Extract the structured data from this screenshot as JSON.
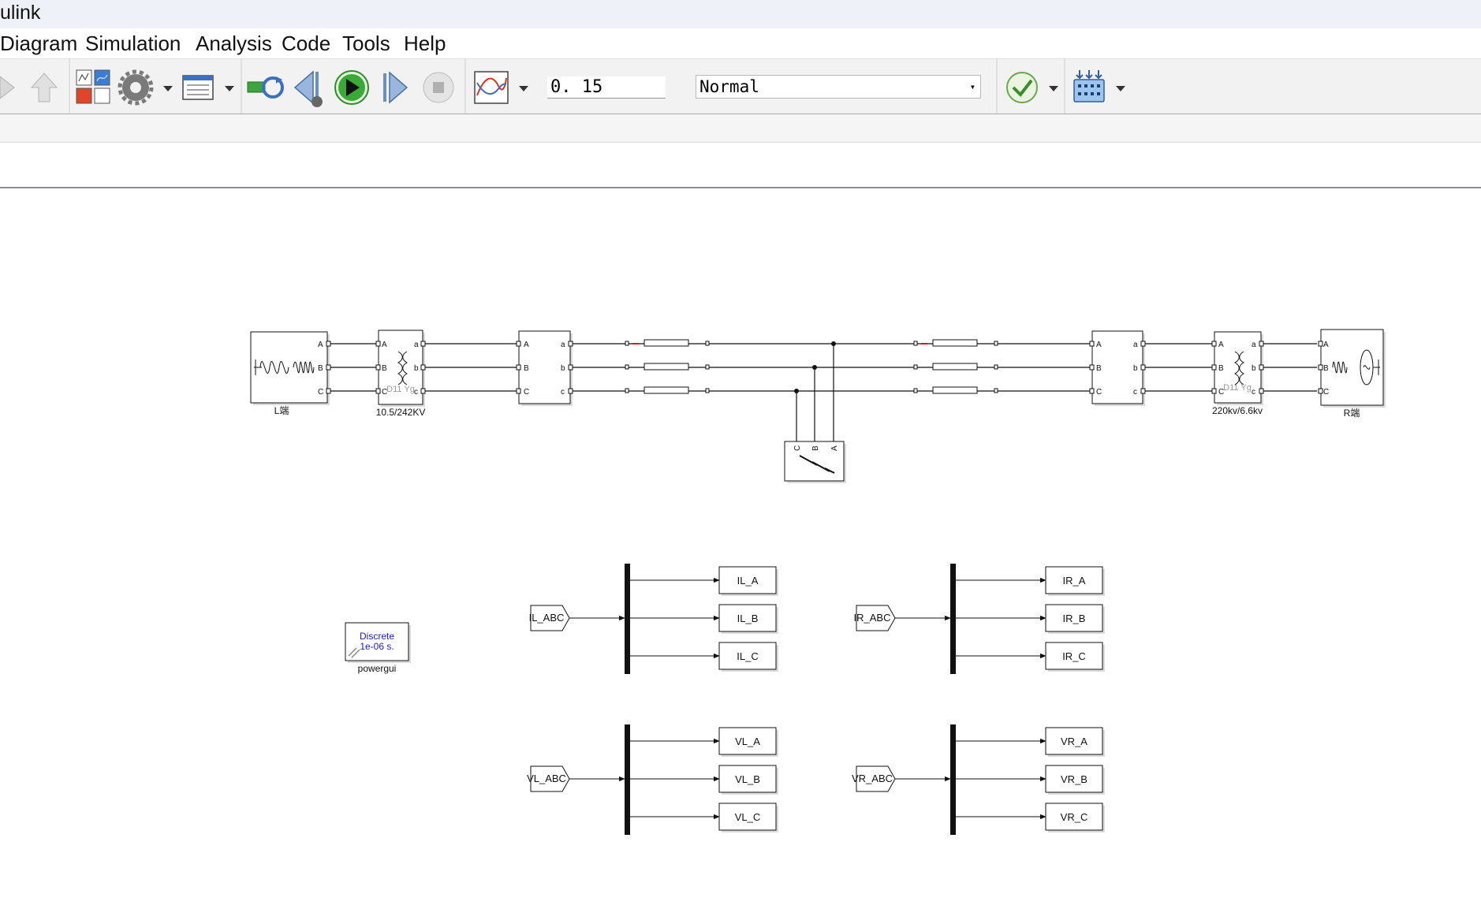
{
  "window": {
    "title": "ulink"
  },
  "menu": [
    {
      "label": "Diagram"
    },
    {
      "label": "Simulation"
    },
    {
      "label": "Analysis"
    },
    {
      "label": "Code"
    },
    {
      "label": "Tools"
    },
    {
      "label": "Help"
    }
  ],
  "toolbar": {
    "stop_time": "0. 15",
    "sim_mode": "Normal",
    "icons": [
      "back-arrow-icon",
      "up-arrow-icon",
      "library-browser-icon",
      "model-settings-gear-icon",
      "model-explorer-icon",
      "step-back-icon",
      "run-icon",
      "step-forward-icon",
      "stop-icon",
      "data-inspector-icon",
      "model-advisor-check-icon",
      "build-icon"
    ]
  },
  "diagram": {
    "source_left_label": "L端",
    "transformer_left_label": "10.5/242KV",
    "transformer_left_type": "D11 Yg",
    "transformer_right_label": "220kv/6.6kv",
    "transformer_right_type": "D11 Yg",
    "source_right_label": "R端",
    "port_A": "A",
    "port_B": "B",
    "port_C": "C",
    "port_a": "a",
    "port_b": "b",
    "port_c": "c",
    "powergui": {
      "line1": "Discrete",
      "line2": "1e-06 s.",
      "label": "powergui"
    },
    "from_tags": {
      "il": "IL_ABC",
      "ir": "IR_ABC",
      "vl": "VL_ABC",
      "vr": "VR_ABC"
    },
    "goto_tags": {
      "il_a": "IL_A",
      "il_b": "IL_B",
      "il_c": "IL_C",
      "ir_a": "IR_A",
      "ir_b": "IR_B",
      "ir_c": "IR_C",
      "vl_a": "VL_A",
      "vl_b": "VL_B",
      "vl_c": "VL_C",
      "vr_a": "VR_A",
      "vr_b": "VR_B",
      "vr_c": "VR_C"
    }
  }
}
